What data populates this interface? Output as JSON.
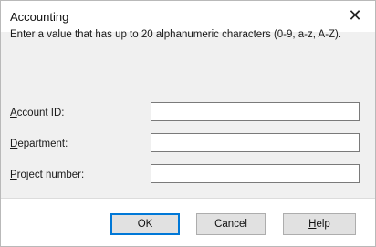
{
  "window": {
    "title": "Accounting",
    "close_glyph": "✕"
  },
  "description": "Enter a value that has up to 20 alphanumeric characters (0-9, a-z, A-Z).",
  "fields": [
    {
      "mnemonic": "A",
      "label_rest": "ccount ID:",
      "value": ""
    },
    {
      "mnemonic": "D",
      "label_rest": "epartment:",
      "value": ""
    },
    {
      "mnemonic": "P",
      "label_rest": "roject number:",
      "value": ""
    }
  ],
  "buttons": {
    "ok": "OK",
    "cancel": "Cancel",
    "help_mnemonic": "H",
    "help_rest": "elp"
  },
  "colors": {
    "accent": "#0078d7",
    "panel": "#f0f0f0"
  }
}
